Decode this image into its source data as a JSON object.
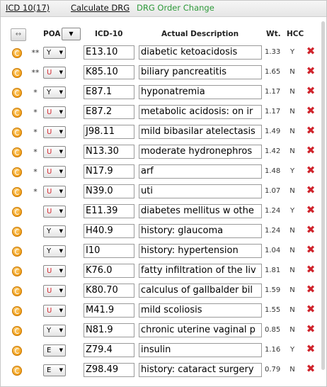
{
  "tabs": [
    {
      "label": "ICD 10(17)"
    },
    {
      "label": "Calculate DRG"
    },
    {
      "label": "DRG Order Change"
    }
  ],
  "columns": {
    "expand_icon": "resize-horizontal-icon",
    "poa": "POA",
    "icd": "ICD-10",
    "desc": "Actual Description",
    "wt": "Wt.",
    "hcc": "HCC"
  },
  "colors": {
    "accent_green": "#2e9a3a",
    "poa_red": "#d0242c",
    "delete_red": "#d0242c",
    "flag_orange": "#f2a21e"
  },
  "rows": [
    {
      "stars": "**",
      "poa": "Y",
      "code": "E13.10",
      "desc": "diabetic ketoacidosis",
      "wt": "1.33",
      "hcc": "Y"
    },
    {
      "stars": "**",
      "poa": "U",
      "code": "K85.10",
      "desc": "biliary pancreatitis",
      "wt": "1.65",
      "hcc": "N"
    },
    {
      "stars": "*",
      "poa": "Y",
      "code": "E87.1",
      "desc": "hyponatremia",
      "wt": "1.17",
      "hcc": "N"
    },
    {
      "stars": "*",
      "poa": "U",
      "code": "E87.2",
      "desc": "metabolic acidosis: on ir",
      "wt": "1.17",
      "hcc": "N"
    },
    {
      "stars": "*",
      "poa": "U",
      "code": "J98.11",
      "desc": "mild bibasilar atelectasis",
      "wt": "1.49",
      "hcc": "N"
    },
    {
      "stars": "*",
      "poa": "U",
      "code": "N13.30",
      "desc": "moderate hydronephros",
      "wt": "1.42",
      "hcc": "N"
    },
    {
      "stars": "*",
      "poa": "U",
      "code": "N17.9",
      "desc": "arf",
      "wt": "1.48",
      "hcc": "Y"
    },
    {
      "stars": "*",
      "poa": "U",
      "code": "N39.0",
      "desc": "uti",
      "wt": "1.07",
      "hcc": "N"
    },
    {
      "stars": "",
      "poa": "U",
      "code": "E11.39",
      "desc": "diabetes mellitus w othe",
      "wt": "1.24",
      "hcc": "Y"
    },
    {
      "stars": "",
      "poa": "Y",
      "code": "H40.9",
      "desc": "history: glaucoma",
      "wt": "1.24",
      "hcc": "N"
    },
    {
      "stars": "",
      "poa": "Y",
      "code": "I10",
      "desc": "history: hypertension",
      "wt": "1.04",
      "hcc": "N"
    },
    {
      "stars": "",
      "poa": "U",
      "code": "K76.0",
      "desc": "fatty infiltration of the liv",
      "wt": "1.81",
      "hcc": "N"
    },
    {
      "stars": "",
      "poa": "U",
      "code": "K80.70",
      "desc": "calculus of gallbalder bil",
      "wt": "1.59",
      "hcc": "N"
    },
    {
      "stars": "",
      "poa": "U",
      "code": "M41.9",
      "desc": "mild scoliosis",
      "wt": "1.55",
      "hcc": "N"
    },
    {
      "stars": "",
      "poa": "Y",
      "code": "N81.9",
      "desc": "chronic uterine vaginal p",
      "wt": "0.85",
      "hcc": "N"
    },
    {
      "stars": "",
      "poa": "E",
      "code": "Z79.4",
      "desc": "insulin",
      "wt": "1.16",
      "hcc": "Y"
    },
    {
      "stars": "",
      "poa": "E",
      "code": "Z98.49",
      "desc": "history: cataract surgery",
      "wt": "0.79",
      "hcc": "N"
    }
  ]
}
